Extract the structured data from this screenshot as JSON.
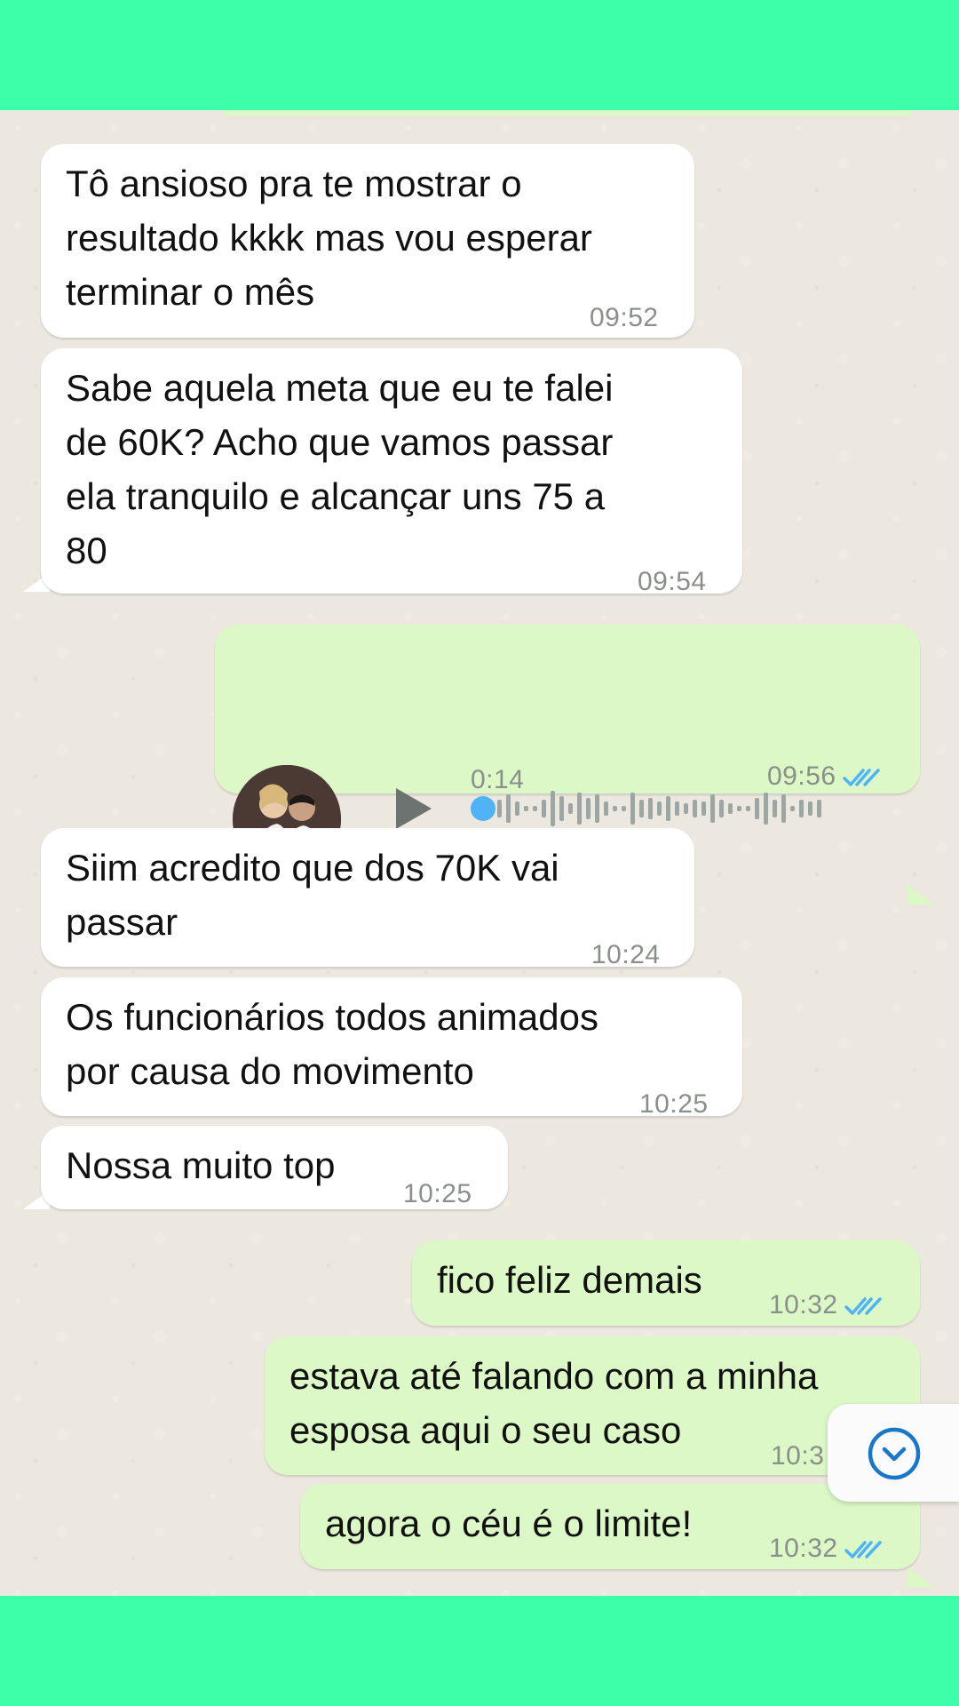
{
  "messages": [
    {
      "type": "in",
      "text": "Tô ansioso pra te mostrar o\nresultado kkkk mas vou esperar\nterminar o mês",
      "time": "09:52"
    },
    {
      "type": "in",
      "text": "Sabe aquela meta que eu te falei\nde 60K? Acho que vamos passar\nela tranquilo e alcançar uns 75 a\n80",
      "time": "09:54"
    },
    {
      "type": "voice",
      "duration": "0:14",
      "time": "09:56",
      "status": "read"
    },
    {
      "type": "in",
      "text": "Siim acredito que dos 70K vai\npassar",
      "time": "10:24"
    },
    {
      "type": "in",
      "text": "Os funcionários todos animados\npor causa do movimento",
      "time": "10:25"
    },
    {
      "type": "in",
      "text": "Nossa muito top",
      "time": "10:25"
    },
    {
      "type": "out",
      "text": "fico feliz demais",
      "time": "10:32",
      "status": "read"
    },
    {
      "type": "out",
      "text": "estava até falando com a minha\nesposa aqui o seu caso",
      "time": "10:3",
      "status": "read"
    },
    {
      "type": "out",
      "text": "agora o céu é o limite!",
      "time": "10:32",
      "status": "read"
    }
  ],
  "icons": {
    "play": "play-icon",
    "mic": "microphone-icon",
    "read_ticks": "double-check-icon",
    "scroll_down": "chevron-down-circle-icon"
  },
  "colors": {
    "outer_band": "#3dfea8",
    "chat_background": "#ece7df",
    "incoming_bubble": "#ffffff",
    "outgoing_bubble": "#dcf8c6",
    "read_ticks": "#4fb3f6",
    "scroll_button_icon": "#1877c9"
  }
}
